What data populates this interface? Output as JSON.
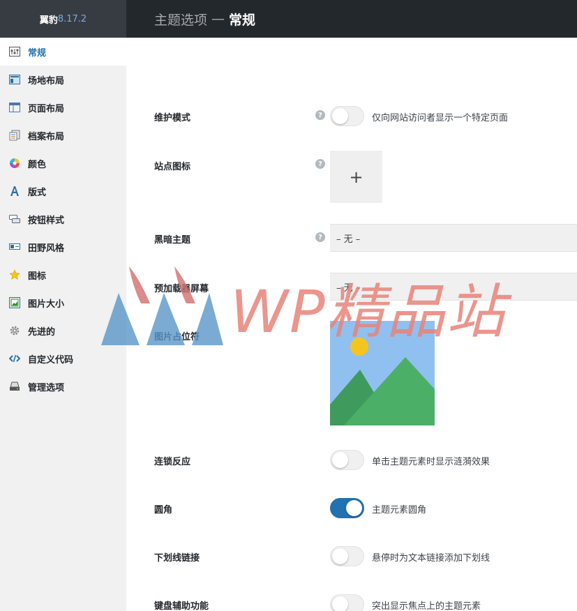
{
  "brand": {
    "name": "翼豹",
    "version": "8.17.2"
  },
  "header": {
    "section": "主题选项",
    "separator": "—",
    "current": "常规"
  },
  "sidebar": {
    "items": [
      {
        "label": "常规",
        "icon": "sliders-icon"
      },
      {
        "label": "场地布局",
        "icon": "site-layout-icon"
      },
      {
        "label": "页面布局",
        "icon": "page-layout-icon"
      },
      {
        "label": "档案布局",
        "icon": "archive-layout-icon"
      },
      {
        "label": "颜色",
        "icon": "color-wheel-icon"
      },
      {
        "label": "版式",
        "icon": "typography-icon"
      },
      {
        "label": "按钮样式",
        "icon": "button-style-icon"
      },
      {
        "label": "田野风格",
        "icon": "field-style-icon"
      },
      {
        "label": "图标",
        "icon": "star-icon"
      },
      {
        "label": "图片大小",
        "icon": "image-size-icon"
      },
      {
        "label": "先进的",
        "icon": "gear-icon"
      },
      {
        "label": "自定义代码",
        "icon": "code-icon"
      },
      {
        "label": "管理选项",
        "icon": "manage-options-icon"
      }
    ]
  },
  "settings": {
    "maintenance": {
      "label": "维护模式",
      "desc": "仅向网站访问者显示一个特定页面",
      "on": false
    },
    "site_icon": {
      "label": "站点图标",
      "add": "+"
    },
    "dark_theme": {
      "label": "黑暗主题",
      "value": "– 无 –"
    },
    "preloader": {
      "label": "预加载器屏幕",
      "value": "– 无 –"
    },
    "image_placeholder": {
      "label": "图片占位符"
    },
    "ripple": {
      "label": "连锁反应",
      "desc": "单击主题元素时显示涟漪效果",
      "on": false
    },
    "rounded": {
      "label": "圆角",
      "desc": "主题元素圆角",
      "on": true
    },
    "underline": {
      "label": "下划线链接",
      "desc": "悬停时为文本链接添加下划线",
      "on": false
    },
    "keyboard": {
      "label": "键盘辅助功能",
      "desc": "突出显示焦点上的主题元素",
      "on": false
    }
  },
  "help_glyph": "?",
  "watermark": {
    "text": "WP精品站"
  },
  "colors": {
    "accent": "#2271b1",
    "topbar": "#23282d",
    "sidebar": "#f1f1f1"
  }
}
